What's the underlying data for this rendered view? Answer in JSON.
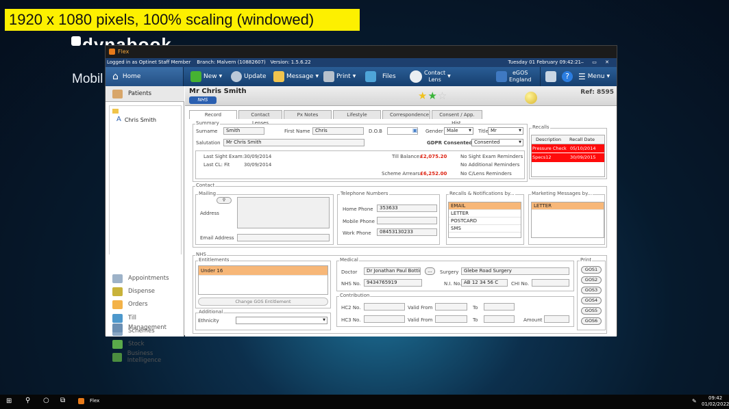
{
  "banner": "1920 x 1080 pixels, 100% scaling (windowed)",
  "desktop": {
    "brand": "dynabook",
    "mobil": "Mobil"
  },
  "window": {
    "app_title": "Flex",
    "status": {
      "user": "Logged in as Optinet Staff Member",
      "branch": "Branch: Malvern (10882607)",
      "version": "Version: 1.5.6.22",
      "datetime": "Tuesday 01 February 09:42:21"
    },
    "toolbar": {
      "home": "Home",
      "new": "New",
      "update": "Update",
      "message": "Message",
      "print": "Print",
      "files": "Files",
      "contact_lens_1": "Contact",
      "contact_lens_2": "Lens",
      "egos_1": "eGOS",
      "egos_2": "England",
      "menu": "Menu"
    }
  },
  "sidebar": {
    "patients": "Patients",
    "patient_item": "Chris Smith",
    "nav": [
      {
        "label": "Appointments"
      },
      {
        "label": "Dispense"
      },
      {
        "label": "Orders"
      },
      {
        "label": "Till"
      },
      {
        "label": "Schemes"
      },
      {
        "label": "Stock"
      },
      {
        "label": "Business Intelligence"
      },
      {
        "label": "Management"
      }
    ]
  },
  "patient": {
    "name": "Mr Chris Smith",
    "badge": "NHS",
    "stars": "★★☆",
    "ref": "Ref: 8595"
  },
  "tabs": [
    {
      "label": "Record"
    },
    {
      "label": "Contact Lenses"
    },
    {
      "label": "Px Notes"
    },
    {
      "label": "Lifestyle"
    },
    {
      "label": "Correspondence"
    },
    {
      "label": "Consent / App. Hist."
    }
  ],
  "summary": {
    "legend": "Summary",
    "surname_label": "Surname",
    "surname": "Smith",
    "first_label": "First Name",
    "first": "Chris",
    "dob_label": "D.O.B",
    "dob": "",
    "gender_label": "Gender",
    "gender": "Male",
    "title_label": "Title",
    "title": "Mr",
    "salutation_label": "Salutation",
    "salutation": "Mr Chris Smith",
    "gdpr_label": "GDPR Consented",
    "gdpr": "Consented",
    "last_sight_label": "Last Sight Exam:",
    "last_sight": "30/09/2014",
    "last_cl_label": "Last CL: Fit",
    "last_cl": "30/09/2014",
    "till_label": "Till Balance:",
    "till": "£2,075.20",
    "arrears_label": "Scheme Arrears:",
    "arrears": "£6,252.00",
    "reminders": [
      "No Sight Exam Reminders",
      "No Additional Reminders",
      "No C/Lens Reminders"
    ]
  },
  "recalls": {
    "legend": "Recalls",
    "col1": "Description",
    "col2": "Recall Date",
    "rows": [
      {
        "desc": "Pressure Check",
        "date": "05/10/2014"
      },
      {
        "desc": "Specs12",
        "date": "30/09/2015"
      }
    ]
  },
  "contact": {
    "legend": "Contact",
    "mailing": "Mailing",
    "address_label": "Address",
    "email_label": "Email Address",
    "email": "",
    "phones_legend": "Telephone Numbers",
    "home_label": "Home Phone",
    "home": "353633",
    "mobile_label": "Mobile Phone",
    "mobile": "",
    "work_label": "Work Phone",
    "work": "08453130233",
    "recall_notif_legend": "Recalls & Notifications by...",
    "recall_notif": [
      "EMAIL",
      "LETTER",
      "POSTCARD",
      "SMS"
    ],
    "marketing_legend": "Marketing Messages by...",
    "marketing": [
      "LETTER"
    ]
  },
  "nhs": {
    "legend": "NHS",
    "entitlements_legend": "Entitlements",
    "entitlement": "Under 16",
    "change_btn": "Change GOS Entitlement",
    "additional_legend": "Additional",
    "ethnicity_label": "Ethnicity",
    "ethnicity": "",
    "medical_legend": "Medical",
    "doctor_label": "Doctor",
    "doctor": "Dr Jonathan Paul Botting",
    "ellipsis": "...",
    "surgery_label": "Surgery",
    "surgery": "Glebe Road Surgery",
    "nhsno_label": "NHS No.",
    "nhsno": "9434765919",
    "ni_label": "N.I. No.",
    "ni": "AB 12 34 56 C",
    "chi_label": "CHI No.",
    "chi": "",
    "contrib_legend": "Contribution",
    "hc2_label": "HC2 No.",
    "hc3_label": "HC3 No.",
    "valid_from_label": "Valid From",
    "to_label": "To",
    "amount_label": "Amount",
    "print_legend": "Print",
    "gos": [
      "GOS1",
      "GOS2",
      "GOS3",
      "GOS4",
      "GOS5",
      "GOS6"
    ]
  },
  "taskbar": {
    "app": "Flex",
    "time": "09:42",
    "date": "01/02/2022"
  }
}
